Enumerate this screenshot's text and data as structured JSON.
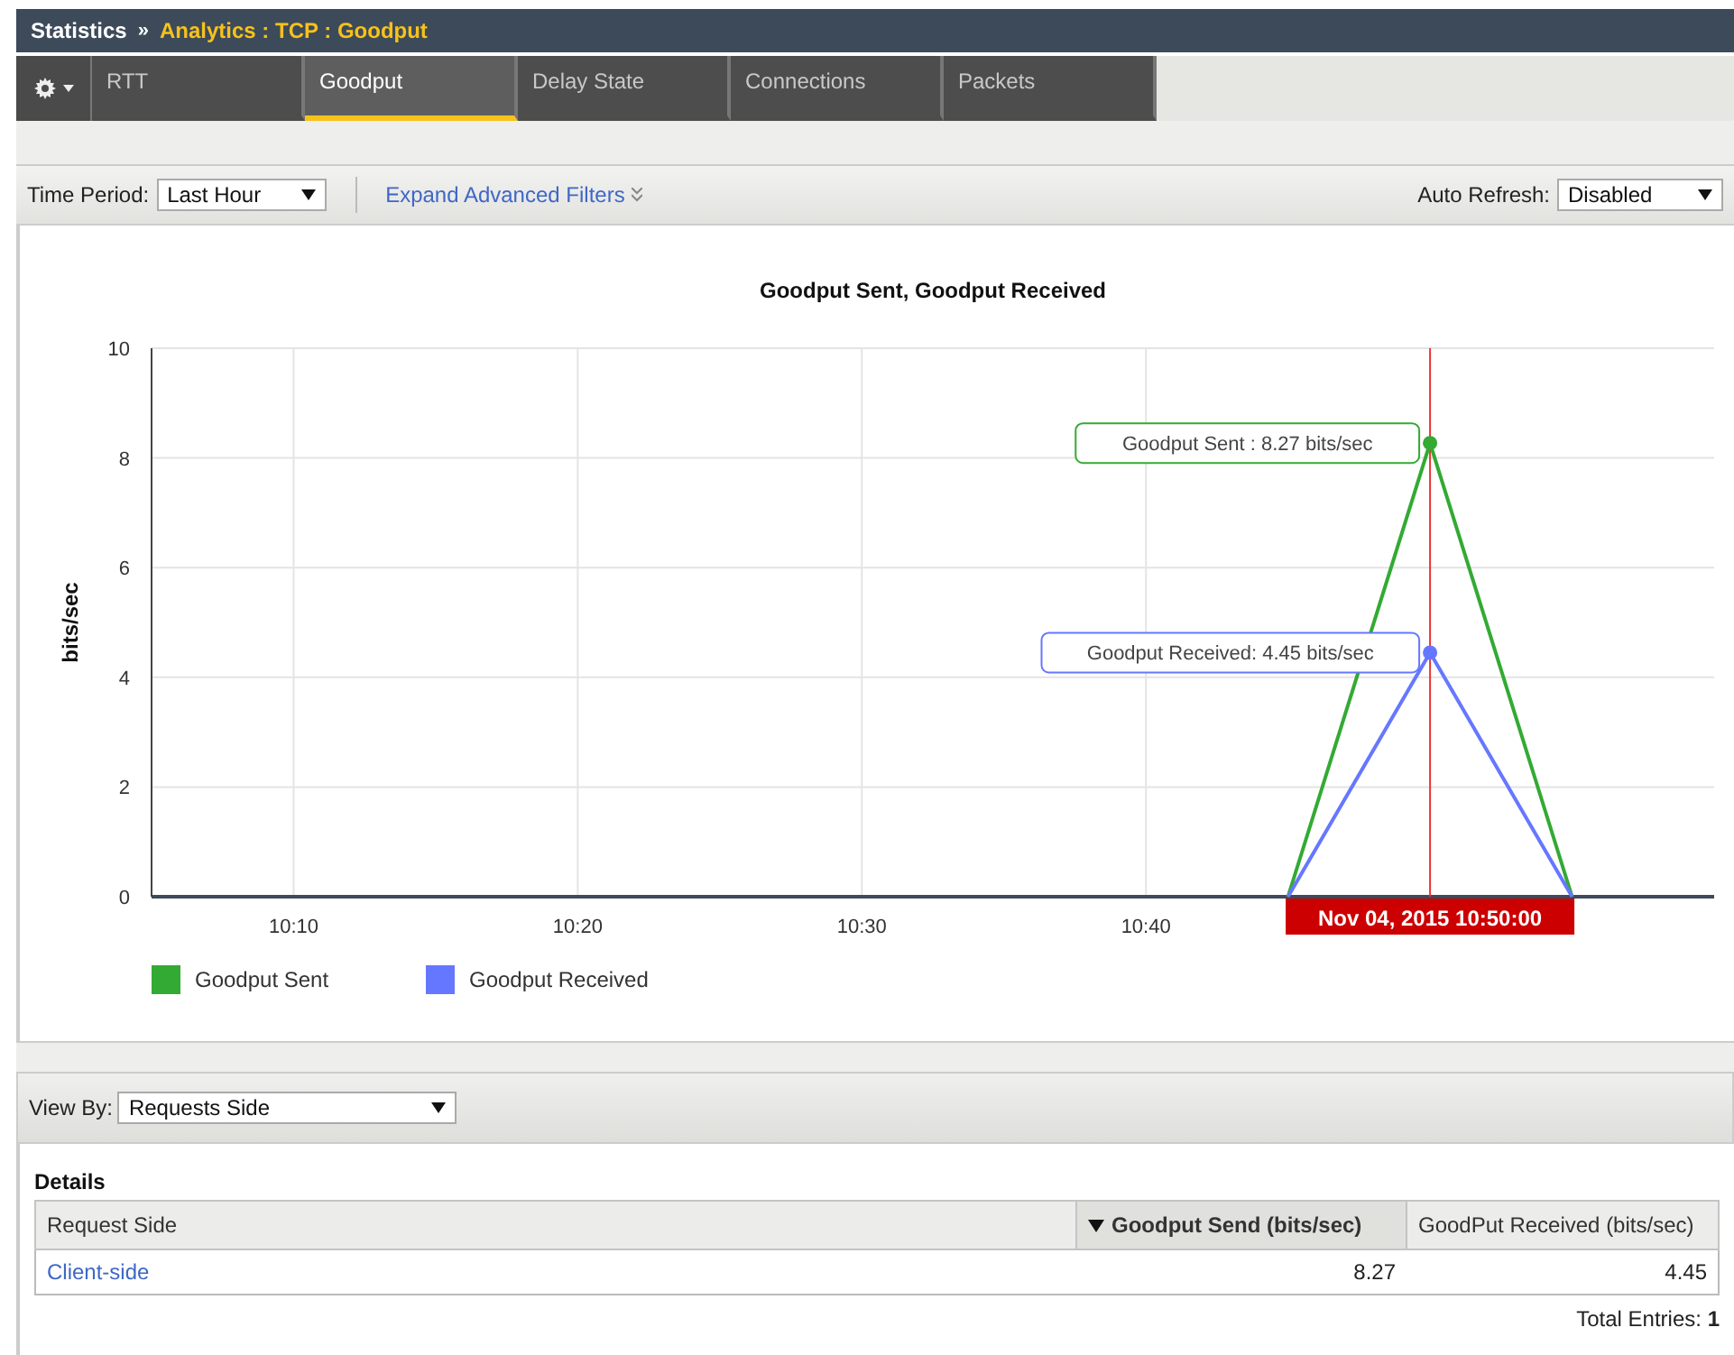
{
  "breadcrumb": {
    "root": "Statistics",
    "separator": "»",
    "path": "Analytics : TCP : Goodput"
  },
  "tabs": [
    {
      "label": "RTT",
      "selected": false
    },
    {
      "label": "Goodput",
      "selected": true
    },
    {
      "label": "Delay State",
      "selected": false
    },
    {
      "label": "Connections",
      "selected": false
    },
    {
      "label": "Packets",
      "selected": false
    }
  ],
  "filters": {
    "time_period": {
      "label": "Time Period:",
      "value": "Last Hour"
    },
    "advanced_link": "Expand Advanced Filters",
    "auto_refresh": {
      "label": "Auto Refresh:",
      "value": "Disabled"
    }
  },
  "chart": {
    "chart_data": {
      "type": "line",
      "title": "Goodput Sent, Goodput Received",
      "ylabel": "bits/sec",
      "categories": [
        null,
        "10:10",
        null,
        "10:20",
        null,
        "10:30",
        null,
        "10:40",
        null,
        null,
        null,
        null
      ],
      "series": [
        {
          "name": "Goodput Sent",
          "color": "#33aa33",
          "values": [
            null,
            null,
            null,
            null,
            null,
            null,
            null,
            null,
            0,
            8.27,
            0,
            null
          ]
        },
        {
          "name": "Goodput Received",
          "color": "#6677ff",
          "values": [
            null,
            null,
            null,
            null,
            null,
            null,
            null,
            null,
            0,
            4.45,
            0,
            null
          ]
        }
      ],
      "ylim": [
        0,
        10
      ],
      "yticks": [
        0,
        2,
        4,
        6,
        8,
        10
      ],
      "grid": true,
      "legend": "bottom-left"
    },
    "tooltips": [
      "Goodput Sent : 8.27 bits/sec",
      "Goodput Received: 4.45 bits/sec"
    ],
    "cursor_label": "Nov 04, 2015 10:50:00"
  },
  "view_by": {
    "label": "View By:",
    "value": "Requests Side"
  },
  "details": {
    "title": "Details",
    "columns": [
      {
        "label": "Request Side",
        "sorted": false
      },
      {
        "label": "Goodput Send (bits/sec)",
        "sorted": true
      },
      {
        "label": "GoodPut Received (bits/sec)",
        "sorted": false
      }
    ],
    "rows": [
      [
        "Client-side",
        "8.27",
        "4.45"
      ]
    ],
    "total": {
      "label": "Total Entries:",
      "value": "1"
    }
  }
}
